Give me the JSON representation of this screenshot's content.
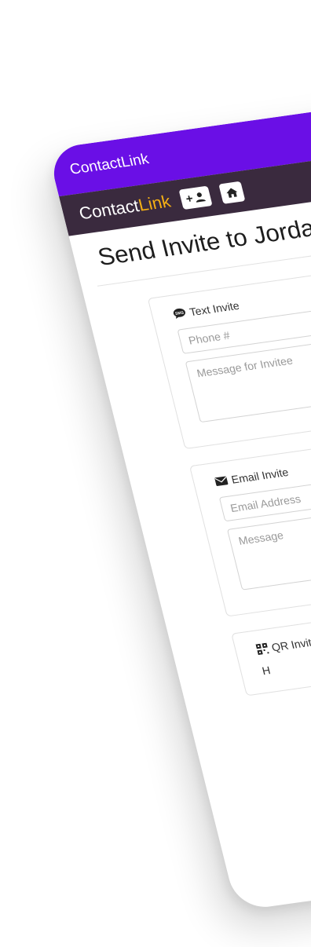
{
  "statusbar": {
    "app_name": "ContactLink"
  },
  "navbar": {
    "brand_prefix": "Contact",
    "brand_accent": "Link",
    "add_user_label": "+",
    "home_icon": "home-icon",
    "add_icon": "person-icon"
  },
  "page": {
    "title": "Send Invite to Jordan Walker"
  },
  "text_invite": {
    "title": "Text Invite",
    "icon": "sms-icon",
    "phone_placeholder": "Phone #",
    "message_placeholder": "Message for Invitee"
  },
  "email_invite": {
    "title": "Email Invite",
    "icon": "envelope-icon",
    "email_placeholder": "Email Address",
    "message_placeholder": "Message"
  },
  "qr_invite": {
    "icon": "qr-icon",
    "title": "QR Invite",
    "text": "H"
  },
  "colors": {
    "statusbar": "#6a0fe6",
    "navbar": "#3a2a3e",
    "brand_accent": "#f5b014"
  }
}
